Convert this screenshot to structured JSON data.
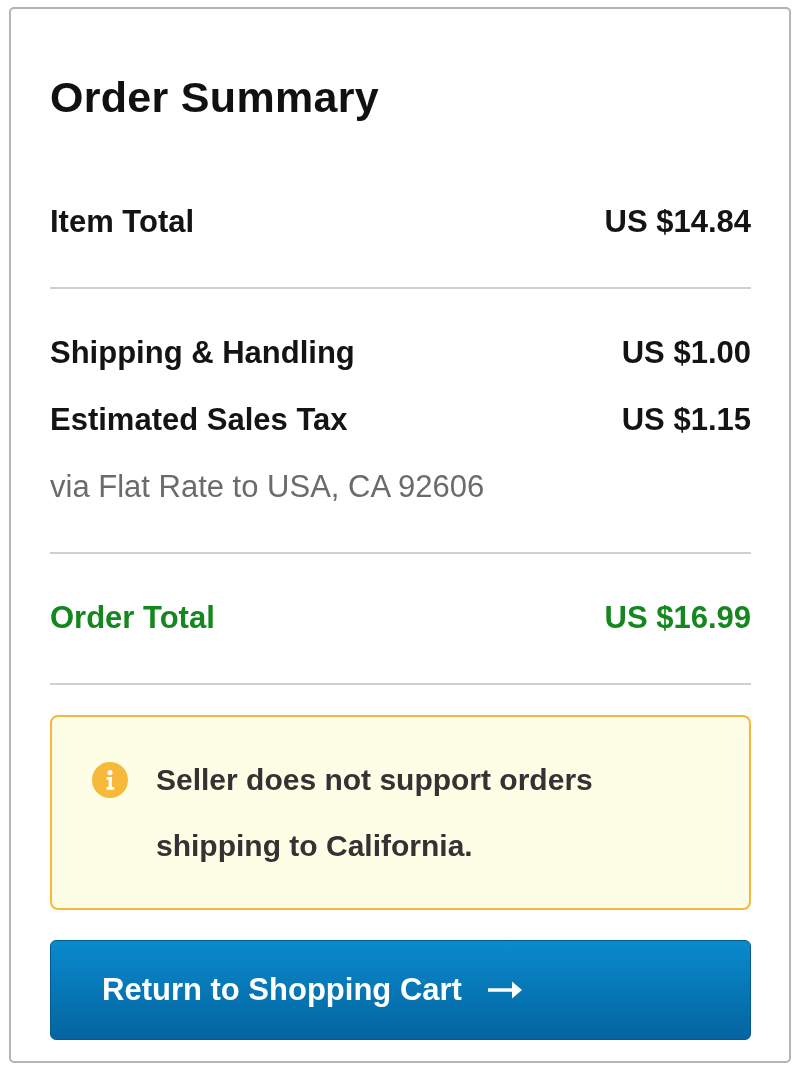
{
  "card": {
    "title": "Order Summary"
  },
  "groups": [
    {
      "rows": [
        {
          "kind": "line",
          "label": "Item Total",
          "value": "US $14.84"
        }
      ]
    },
    {
      "rows": [
        {
          "kind": "line",
          "label": "Shipping & Handling",
          "value": "US $1.00"
        },
        {
          "kind": "line",
          "label": "Estimated Sales Tax",
          "value": "US $1.15"
        },
        {
          "kind": "note",
          "label": "via Flat Rate to USA, CA 92606"
        }
      ]
    },
    {
      "rows": [
        {
          "kind": "total",
          "label": "Order Total",
          "value": "US $16.99"
        }
      ]
    }
  ],
  "alert": {
    "kind": "info",
    "text": "Seller does not support orders shipping to California."
  },
  "button": {
    "label": "Return to Shopping Cart"
  }
}
